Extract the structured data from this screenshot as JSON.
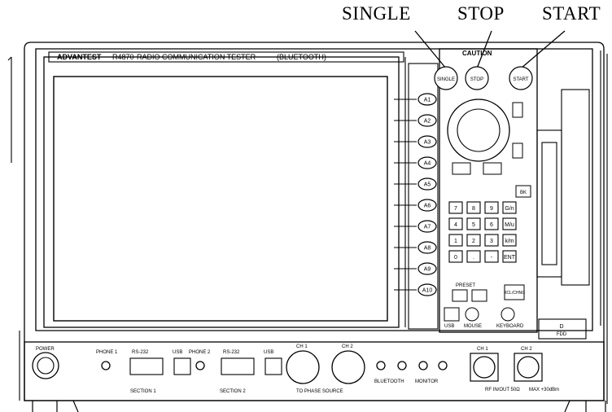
{
  "callouts": {
    "single": "SINGLE",
    "stop": "STOP",
    "start": "START"
  },
  "header": {
    "brand": "ADVANTEST",
    "model": "R4870",
    "title": "RADIO COMMUNICATION TESTER",
    "option": "(BLUETOOTH)"
  },
  "caution": {
    "title": "CAUTION"
  },
  "control_buttons": {
    "single": "SINGLE",
    "stop": "STOP",
    "start": "START"
  },
  "softkeys": [
    "A1",
    "A2",
    "A3",
    "A4",
    "A5",
    "A6",
    "A7",
    "A8",
    "A9",
    "A10"
  ],
  "keypad": {
    "bk": "BK",
    "rows": [
      [
        "7",
        "8",
        "9",
        "G/n"
      ],
      [
        "4",
        "5",
        "6",
        "M/u"
      ],
      [
        "1",
        "2",
        "3",
        "k/m"
      ],
      [
        "0",
        ".",
        "-",
        "ENT"
      ]
    ],
    "preset_label": "PRESET",
    "preset_aux": "RCL/CHNG"
  },
  "ports": {
    "usb": "USB",
    "mouse": "MOUSE",
    "keyboard": "KEYBOARD"
  },
  "floppy": {
    "label": "D",
    "sublabel": "FDD"
  },
  "bottom": {
    "power": "POWER",
    "power_group": [
      "PHONE 1",
      "RS-232",
      "USB",
      "PHONE 2",
      "RS-232",
      "USB"
    ],
    "ch_labels": [
      "CH 1",
      "CH 2"
    ],
    "audio_source": "TO PHASE SOURCE",
    "bt_group": "BLUETOOTH",
    "monitor": "MONITOR",
    "rf_in": "CH 1",
    "rf_out": "CH 2",
    "rf_note": "RF IN/OUT 50Ω",
    "max_note": "MAX +30dBm",
    "section_1": "SECTION 1",
    "section_2": "SECTION 2"
  }
}
